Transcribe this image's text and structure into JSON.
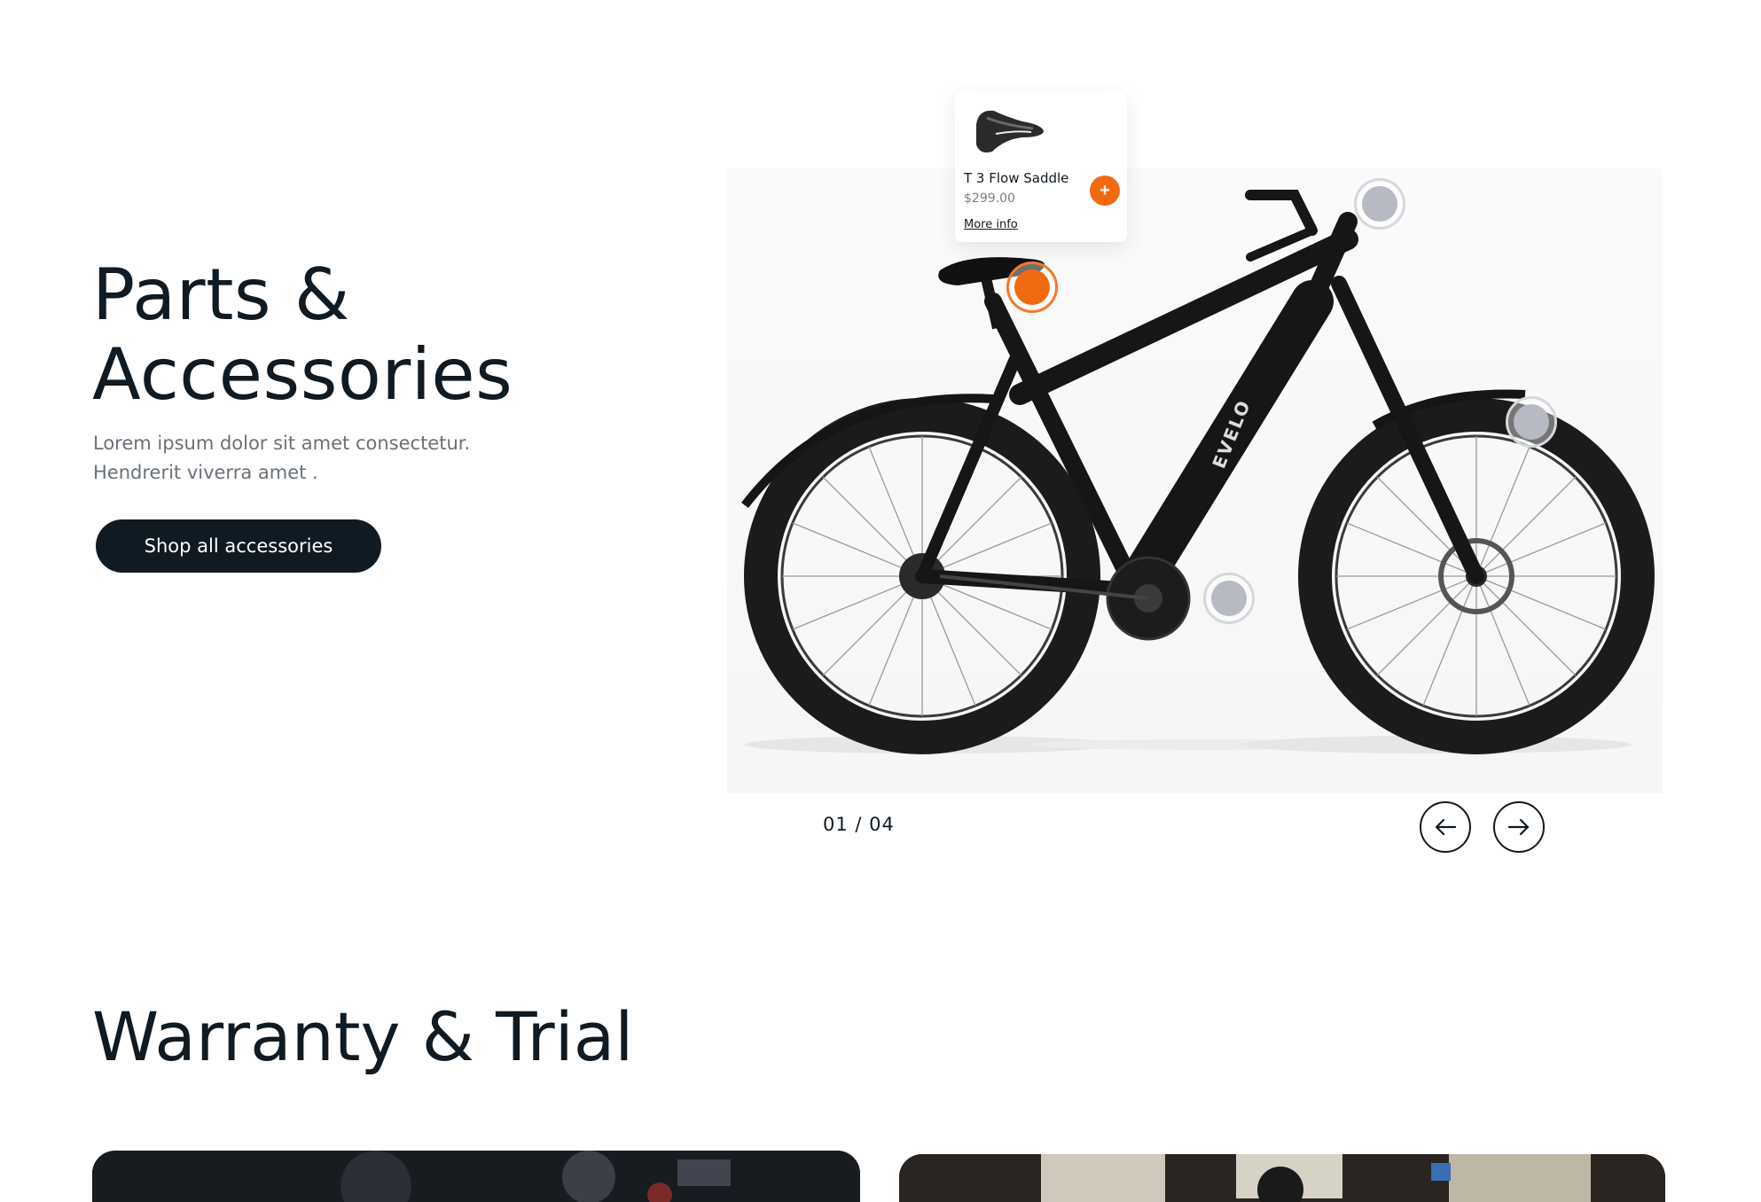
{
  "hero": {
    "title_line1": "Parts &",
    "title_line2": "Accessories",
    "desc_line1": "Lorem ipsum dolor sit amet consectetur.",
    "desc_line2": "Hendrerit viverra amet .",
    "cta_label": "Shop all accessories"
  },
  "product_popup": {
    "name": "T 3 Flow Saddle",
    "price": "$299.00",
    "link_label": "More info",
    "add_icon": "+"
  },
  "bike": {
    "frame_text": "EVELO"
  },
  "carousel": {
    "counter": "01 / 04"
  },
  "section": {
    "title": "Warranty & Trial"
  },
  "colors": {
    "accent": "#f26a10",
    "dark": "#0f1a22",
    "muted": "#6a7178",
    "hotspot": "#b7b9c3"
  }
}
